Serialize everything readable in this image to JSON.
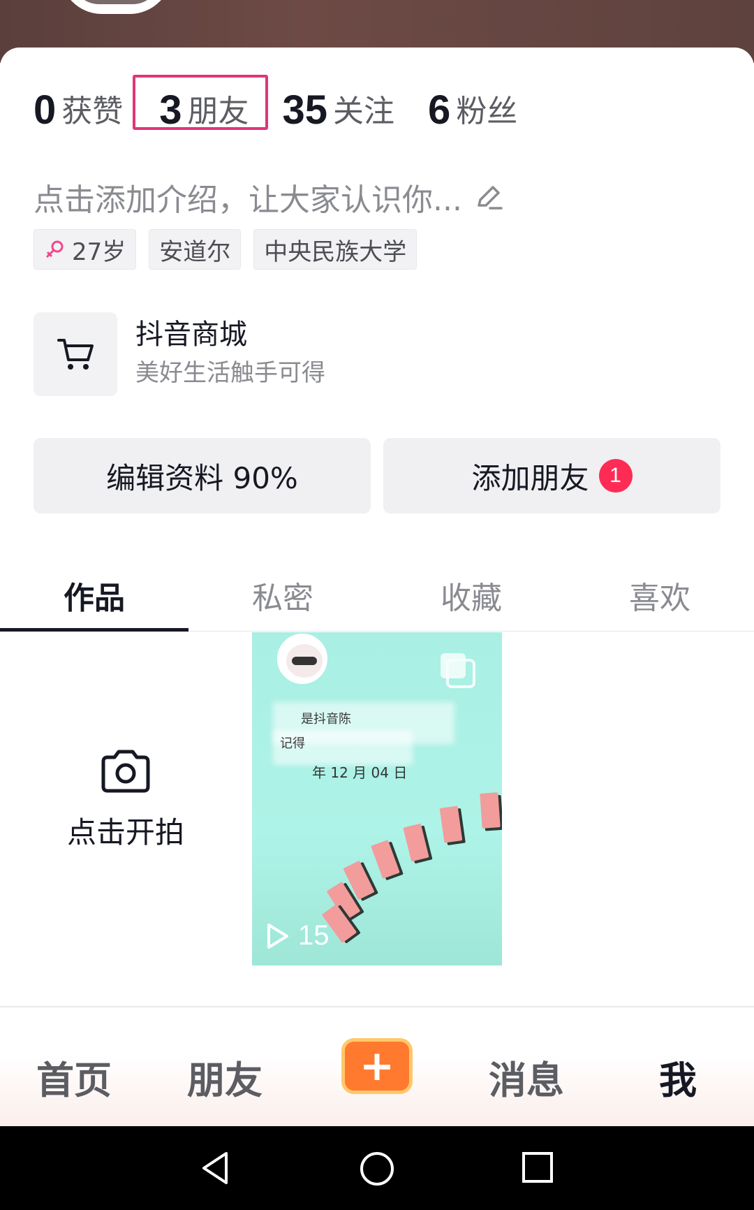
{
  "stats": [
    {
      "num": "0",
      "label": "获赞"
    },
    {
      "num": "3",
      "label": "朋友"
    },
    {
      "num": "35",
      "label": "关注"
    },
    {
      "num": "6",
      "label": "粉丝"
    }
  ],
  "bio": {
    "placeholder": "点击添加介绍，让大家认识你..."
  },
  "tags": {
    "age": "27岁",
    "city": "安道尔",
    "school": "中央民族大学"
  },
  "shop": {
    "title": "抖音商城",
    "subtitle": "美好生活触手可得"
  },
  "buttons": {
    "edit_profile": "编辑资料 90%",
    "add_friend": "添加朋友",
    "add_friend_badge": "1"
  },
  "tabs": [
    "作品",
    "私密",
    "收藏",
    "喜欢"
  ],
  "grid": {
    "shoot_label": "点击开拍",
    "video": {
      "date_text": "年 12 月 04 日",
      "caption_1": "是抖音陈",
      "caption_2": "记得",
      "plays": "15"
    }
  },
  "bottom_nav": {
    "home": "首页",
    "friends": "朋友",
    "plus": "+",
    "messages": "消息",
    "me": "我"
  },
  "colors": {
    "accent": "#fe2c55",
    "highlight": "#e0357a",
    "plus_button": "#ff7a2e"
  }
}
